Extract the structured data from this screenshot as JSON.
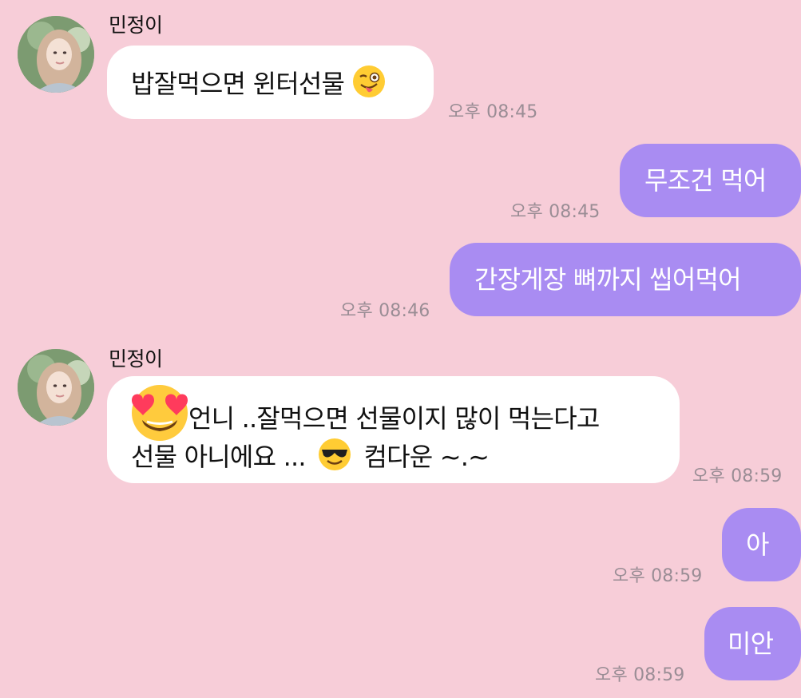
{
  "colors": {
    "background": "#f7cdd8",
    "incoming_bubble": "#ffffff",
    "outgoing_bubble": "#a98cf2",
    "timestamp": "#9a8d95"
  },
  "contact": {
    "name": "민정이"
  },
  "messages": [
    {
      "direction": "incoming",
      "text": "밥잘먹으면 윈터선물",
      "emoji": "winking-tongue-face",
      "time": "오후 08:45"
    },
    {
      "direction": "outgoing",
      "text": "무조건 먹어",
      "time": "오후 08:45"
    },
    {
      "direction": "outgoing",
      "text": "간장게장 뼈까지 씹어먹어",
      "time": "오후 08:46"
    },
    {
      "direction": "incoming",
      "line1": "언니 ..잘먹으면 선물이지 많이 먹는다고",
      "line2a": "선물 아니에요 ...",
      "line2b": "컴다운 ~.~",
      "emoji_overlay": "heart-eyes-face",
      "emoji_inline": "sunglasses-face",
      "time": "오후 08:59"
    },
    {
      "direction": "outgoing",
      "text": "아",
      "time": "오후 08:59"
    },
    {
      "direction": "outgoing",
      "text": "미안",
      "time": "오후 08:59"
    }
  ]
}
